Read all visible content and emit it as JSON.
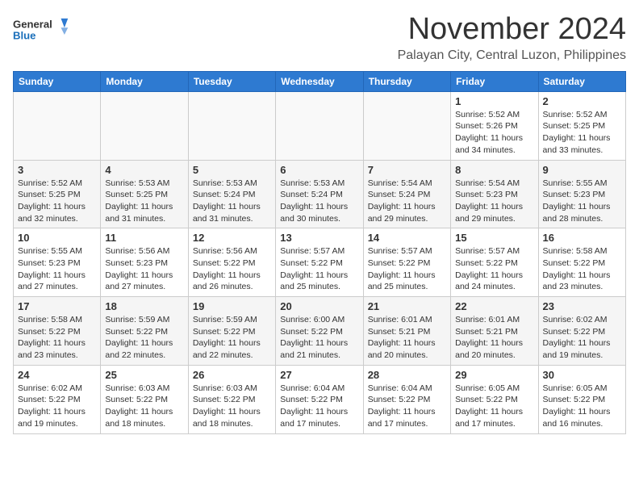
{
  "logo": {
    "line1": "General",
    "line2": "Blue"
  },
  "header": {
    "month": "November 2024",
    "location": "Palayan City, Central Luzon, Philippines"
  },
  "weekdays": [
    "Sunday",
    "Monday",
    "Tuesday",
    "Wednesday",
    "Thursday",
    "Friday",
    "Saturday"
  ],
  "weeks": [
    [
      {
        "day": "",
        "info": ""
      },
      {
        "day": "",
        "info": ""
      },
      {
        "day": "",
        "info": ""
      },
      {
        "day": "",
        "info": ""
      },
      {
        "day": "",
        "info": ""
      },
      {
        "day": "1",
        "info": "Sunrise: 5:52 AM\nSunset: 5:26 PM\nDaylight: 11 hours and 34 minutes."
      },
      {
        "day": "2",
        "info": "Sunrise: 5:52 AM\nSunset: 5:25 PM\nDaylight: 11 hours and 33 minutes."
      }
    ],
    [
      {
        "day": "3",
        "info": "Sunrise: 5:52 AM\nSunset: 5:25 PM\nDaylight: 11 hours and 32 minutes."
      },
      {
        "day": "4",
        "info": "Sunrise: 5:53 AM\nSunset: 5:25 PM\nDaylight: 11 hours and 31 minutes."
      },
      {
        "day": "5",
        "info": "Sunrise: 5:53 AM\nSunset: 5:24 PM\nDaylight: 11 hours and 31 minutes."
      },
      {
        "day": "6",
        "info": "Sunrise: 5:53 AM\nSunset: 5:24 PM\nDaylight: 11 hours and 30 minutes."
      },
      {
        "day": "7",
        "info": "Sunrise: 5:54 AM\nSunset: 5:24 PM\nDaylight: 11 hours and 29 minutes."
      },
      {
        "day": "8",
        "info": "Sunrise: 5:54 AM\nSunset: 5:23 PM\nDaylight: 11 hours and 29 minutes."
      },
      {
        "day": "9",
        "info": "Sunrise: 5:55 AM\nSunset: 5:23 PM\nDaylight: 11 hours and 28 minutes."
      }
    ],
    [
      {
        "day": "10",
        "info": "Sunrise: 5:55 AM\nSunset: 5:23 PM\nDaylight: 11 hours and 27 minutes."
      },
      {
        "day": "11",
        "info": "Sunrise: 5:56 AM\nSunset: 5:23 PM\nDaylight: 11 hours and 27 minutes."
      },
      {
        "day": "12",
        "info": "Sunrise: 5:56 AM\nSunset: 5:22 PM\nDaylight: 11 hours and 26 minutes."
      },
      {
        "day": "13",
        "info": "Sunrise: 5:57 AM\nSunset: 5:22 PM\nDaylight: 11 hours and 25 minutes."
      },
      {
        "day": "14",
        "info": "Sunrise: 5:57 AM\nSunset: 5:22 PM\nDaylight: 11 hours and 25 minutes."
      },
      {
        "day": "15",
        "info": "Sunrise: 5:57 AM\nSunset: 5:22 PM\nDaylight: 11 hours and 24 minutes."
      },
      {
        "day": "16",
        "info": "Sunrise: 5:58 AM\nSunset: 5:22 PM\nDaylight: 11 hours and 23 minutes."
      }
    ],
    [
      {
        "day": "17",
        "info": "Sunrise: 5:58 AM\nSunset: 5:22 PM\nDaylight: 11 hours and 23 minutes."
      },
      {
        "day": "18",
        "info": "Sunrise: 5:59 AM\nSunset: 5:22 PM\nDaylight: 11 hours and 22 minutes."
      },
      {
        "day": "19",
        "info": "Sunrise: 5:59 AM\nSunset: 5:22 PM\nDaylight: 11 hours and 22 minutes."
      },
      {
        "day": "20",
        "info": "Sunrise: 6:00 AM\nSunset: 5:22 PM\nDaylight: 11 hours and 21 minutes."
      },
      {
        "day": "21",
        "info": "Sunrise: 6:01 AM\nSunset: 5:21 PM\nDaylight: 11 hours and 20 minutes."
      },
      {
        "day": "22",
        "info": "Sunrise: 6:01 AM\nSunset: 5:21 PM\nDaylight: 11 hours and 20 minutes."
      },
      {
        "day": "23",
        "info": "Sunrise: 6:02 AM\nSunset: 5:22 PM\nDaylight: 11 hours and 19 minutes."
      }
    ],
    [
      {
        "day": "24",
        "info": "Sunrise: 6:02 AM\nSunset: 5:22 PM\nDaylight: 11 hours and 19 minutes."
      },
      {
        "day": "25",
        "info": "Sunrise: 6:03 AM\nSunset: 5:22 PM\nDaylight: 11 hours and 18 minutes."
      },
      {
        "day": "26",
        "info": "Sunrise: 6:03 AM\nSunset: 5:22 PM\nDaylight: 11 hours and 18 minutes."
      },
      {
        "day": "27",
        "info": "Sunrise: 6:04 AM\nSunset: 5:22 PM\nDaylight: 11 hours and 17 minutes."
      },
      {
        "day": "28",
        "info": "Sunrise: 6:04 AM\nSunset: 5:22 PM\nDaylight: 11 hours and 17 minutes."
      },
      {
        "day": "29",
        "info": "Sunrise: 6:05 AM\nSunset: 5:22 PM\nDaylight: 11 hours and 17 minutes."
      },
      {
        "day": "30",
        "info": "Sunrise: 6:05 AM\nSunset: 5:22 PM\nDaylight: 11 hours and 16 minutes."
      }
    ]
  ]
}
